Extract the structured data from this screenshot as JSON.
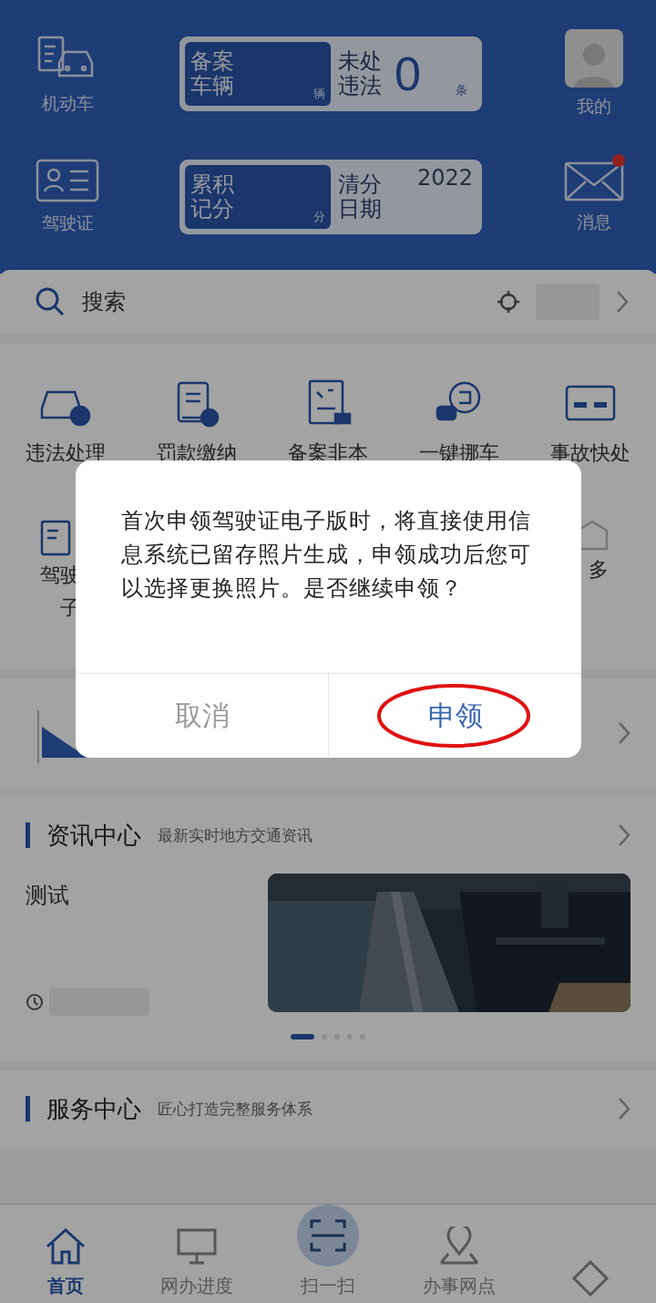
{
  "header": {
    "rows": [
      {
        "left": {
          "label": "机动车"
        },
        "card": {
          "kind": "count",
          "field_label": [
            "备案",
            "车辆"
          ],
          "field_unit": "辆",
          "stat_label": [
            "未处",
            "违法"
          ],
          "stat_value": "0",
          "stat_unit": "条"
        },
        "right": {
          "label": "我的"
        }
      },
      {
        "left": {
          "label": "驾驶证"
        },
        "card": {
          "kind": "date",
          "field_label": [
            "累积",
            "记分"
          ],
          "field_unit": "分",
          "stat_label": [
            "清分",
            "日期"
          ],
          "stat_value": "2022"
        },
        "right": {
          "label": "消息",
          "badge": true
        }
      }
    ]
  },
  "search": {
    "placeholder": "搜索"
  },
  "services": [
    {
      "label": "违法处理"
    },
    {
      "label": "罚款缴纳"
    },
    {
      "label": "备案非本"
    },
    {
      "label": "一键挪车"
    },
    {
      "label": "事故快处"
    }
  ],
  "services_row2": [
    {
      "lines": [
        "驾驶",
        "子"
      ]
    },
    {
      "lines": [
        "多"
      ]
    }
  ],
  "news": {
    "title": "资讯中心",
    "subtitle": "最新实时地方交通资讯",
    "items": [
      {
        "title": "测试",
        "kind": "picture"
      }
    ],
    "dots": [
      {
        "selected": true
      },
      {
        "selected": false
      },
      {
        "selected": false
      },
      {
        "selected": false
      },
      {
        "selected": false
      }
    ]
  },
  "service_center": {
    "title": "服务中心",
    "subtitle": "匠心打造完整服务体系"
  },
  "nav": [
    {
      "label": "首页",
      "selected": true
    },
    {
      "label": "网办进度",
      "selected": false
    },
    {
      "label": "扫一扫",
      "selected": false
    },
    {
      "label": "办事网点",
      "selected": false
    },
    {
      "selected": false
    }
  ],
  "dialog": {
    "message": "首次申领驾驶证电子版时，将直接使用信息系统已留存照片生成，申领成功后您可以选择更换照片。是否继续申领？",
    "buttons": [
      {
        "label": "取消",
        "kind": "cancel",
        "circled": false
      },
      {
        "label": "申领",
        "kind": "confirm",
        "circled": true
      }
    ]
  }
}
